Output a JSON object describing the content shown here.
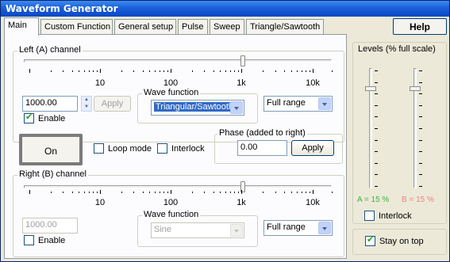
{
  "window": {
    "title": "Waveform Generator"
  },
  "help_label": "Help",
  "tabs": [
    {
      "label": "Main",
      "active": true
    },
    {
      "label": "Custom Function"
    },
    {
      "label": "General setup"
    },
    {
      "label": "Pulse"
    },
    {
      "label": "Sweep"
    },
    {
      "label": "Triangle/Sawtooth"
    }
  ],
  "left_channel": {
    "title": "Left (A) channel",
    "freq_ticks": [
      "10",
      "100",
      "1k",
      "10k"
    ],
    "frequency_value": "1000.00",
    "apply_label": "Apply",
    "enable_label": "Enable",
    "enable_checked": true,
    "wave_function_label": "Wave function",
    "wave_function_value": "Triangular/Sawtooth",
    "range_value": "Full range"
  },
  "controls": {
    "on_label": "On",
    "loop_mode_label": "Loop mode",
    "interlock_label": "Interlock"
  },
  "phase": {
    "title": "Phase (added to right)",
    "value": "0.00",
    "apply_label": "Apply"
  },
  "right_channel": {
    "title": "Right (B) channel",
    "freq_ticks": [
      "10",
      "100",
      "1k",
      "10k"
    ],
    "frequency_value": "1000.00",
    "enable_label": "Enable",
    "enable_checked": false,
    "wave_function_label": "Wave function",
    "wave_function_value": "Sine",
    "range_value": "Full range"
  },
  "levels": {
    "title": "Levels (% full scale)",
    "a_label": "A = 15 %",
    "b_label": "B = 15 %",
    "a_color": "#3cb43c",
    "b_color": "#f08080",
    "interlock_label": "Interlock",
    "a_level_percent": 15,
    "b_level_percent": 15
  },
  "stay_on_top": {
    "label": "Stay on top",
    "checked": true
  }
}
